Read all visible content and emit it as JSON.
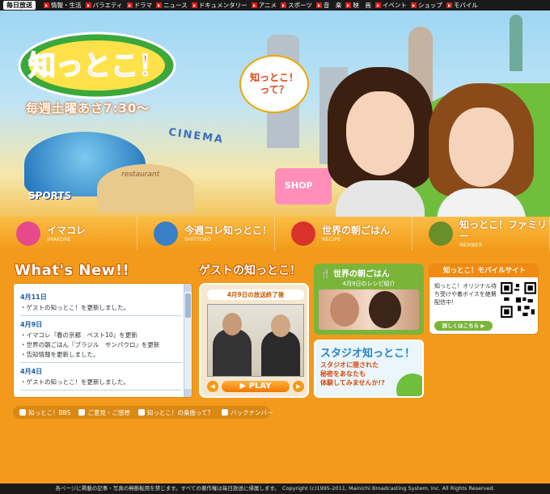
{
  "topnav": {
    "brand": "毎日放送",
    "items": [
      "情報・生活",
      "バラエティ",
      "ドラマ",
      "ニュース",
      "ドキュメンタリー",
      "アニメ",
      "スポーツ",
      "音　楽",
      "映　画",
      "イベント",
      "ショップ",
      "モバイル"
    ]
  },
  "hero": {
    "logo_text": "知っとこ！",
    "slogan": "毎週土曜あさ7:30〜",
    "bubble_line1": "知っとこ！",
    "bubble_line2": "って？",
    "cinema_sign": "CINEMA",
    "sports_sign": "SPORTS",
    "shop_sign": "SHOP",
    "restaurant_sign": "restaurant"
  },
  "categories": [
    {
      "label": "イマコレ",
      "sub": "IMAKORE",
      "color": "#e64a8a"
    },
    {
      "label": "今週コレ知っとこ！",
      "sub": "SHITTOKO",
      "color": "#3a7ec6"
    },
    {
      "label": "世界の朝ごはん",
      "sub": "RECIPE",
      "color": "#d8322a"
    },
    {
      "label": "知っとこ！ファミリー",
      "sub": "MEMBER",
      "color": "#6a8e2a"
    }
  ],
  "whatsnew": {
    "title": "What's New!!",
    "entries": [
      {
        "date": "4月11日",
        "items": [
          "・ゲストの知っとこ！を更新しました。"
        ]
      },
      {
        "date": "4月9日",
        "items": [
          "・イマコレ『春の京都　ベスト10』を更新",
          "・世界の朝ごはん『ブラジル　サンパウロ』を更新",
          "・告知情報を更新しました。"
        ]
      },
      {
        "date": "4月4日",
        "items": [
          "・ゲストの知っとこ！を更新しました。"
        ]
      }
    ]
  },
  "guest": {
    "title": "ゲストの知っとこ！",
    "caption": "4月9日の放送終了後",
    "play_label": "▶ PLAY",
    "prev": "◀",
    "next": "▶"
  },
  "breakfast": {
    "title": "世界の朝ごはん",
    "sub": "4月9日のレシピ紹介"
  },
  "studio": {
    "title": "スタジオ知っとこ！",
    "line1": "スタジオに隠された",
    "line2": "秘密をあなたも",
    "line3": "体験してみませんか!?"
  },
  "mobile": {
    "title": "知っとこ！モバイルサイト",
    "text": "知っとこ！オリジナル待ち受けや着ボイスを絶賛配信中！",
    "button": "詳しくはこちら ▶"
  },
  "footer_links": [
    "知っとこ！BBS",
    "ご意見・ご感想",
    "知っとこ！の楽曲って？",
    "バックナンバー"
  ],
  "copyright": "各ページに掲載の記事・写真の無断転用を禁じます。すべての著作権は毎日放送に帰属します。　Copyright (c)1995-2011, Mainichi Broadcasting System, Inc. All Rights Reserved."
}
